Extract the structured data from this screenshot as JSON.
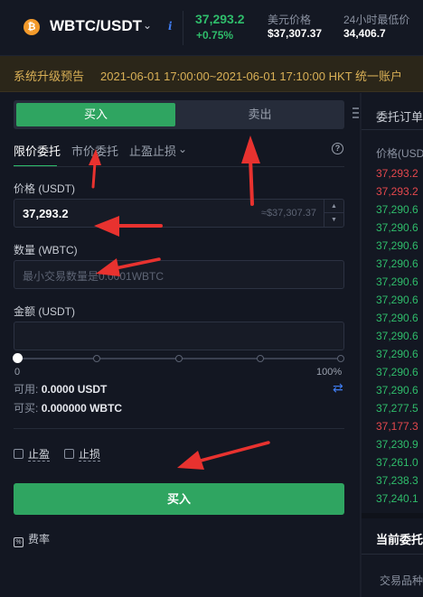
{
  "header": {
    "coin_icon": "bitcoin-icon",
    "coin_glyph": "₿",
    "pair": "WBTC/USDT",
    "caret": "⌄",
    "info_glyph": "i",
    "last_price": "37,293.2",
    "change": "+0.75%",
    "usd_price_label": "美元价格",
    "usd_price_value": "$37,307.37",
    "low_24h_label": "24小时最低价",
    "low_24h_value": "34,406.7"
  },
  "notice": {
    "title": "系统升级预告",
    "text": "2021-06-01 17:00:00~2021-06-01 17:10:00 HKT 统一账户"
  },
  "trade": {
    "buy_tab": "买入",
    "sell_tab": "卖出",
    "order_tabs": [
      "限价委托",
      "市价委托",
      "止盈止损"
    ],
    "dropdown_caret": "⌄",
    "help_glyph": "?",
    "price_label": "价格 (USDT)",
    "price_value": "37,293.2",
    "price_hint": "≈$37,307.37",
    "stepper_up": "▲",
    "stepper_down": "▼",
    "amount_label": "数量 (WBTC)",
    "amount_placeholder": "最小交易数量是0.0001WBTC",
    "total_label": "金额 (USDT)",
    "total_value": "",
    "slider_min": "0",
    "slider_max": "100%",
    "slider_value": 0,
    "available_label": "可用:",
    "available_value": "0.0000 USDT",
    "can_buy_label": "可买:",
    "can_buy_value": "0.000000 WBTC",
    "swap_glyph": "⇄",
    "take_profit": "止盈",
    "stop_loss": "止损",
    "submit": "买入",
    "fee_icon_glyph": "%",
    "fee": "费率"
  },
  "orderbook": {
    "title": "委托订单",
    "col_price": "价格(USDT)",
    "rows": [
      {
        "price": "37,293.2",
        "side": "sell"
      },
      {
        "price": "37,293.2",
        "side": "sell"
      },
      {
        "price": "37,290.6",
        "side": "buy"
      },
      {
        "price": "37,290.6",
        "side": "buy"
      },
      {
        "price": "37,290.6",
        "side": "buy"
      },
      {
        "price": "37,290.6",
        "side": "buy"
      },
      {
        "price": "37,290.6",
        "side": "buy"
      },
      {
        "price": "37,290.6",
        "side": "buy"
      },
      {
        "price": "37,290.6",
        "side": "buy"
      },
      {
        "price": "37,290.6",
        "side": "buy"
      },
      {
        "price": "37,290.6",
        "side": "buy"
      },
      {
        "price": "37,290.6",
        "side": "buy"
      },
      {
        "price": "37,290.6",
        "side": "buy"
      },
      {
        "price": "37,277.5",
        "side": "buy"
      },
      {
        "price": "37,177.3",
        "side": "sell"
      },
      {
        "price": "37,230.9",
        "side": "buy"
      },
      {
        "price": "37,261.0",
        "side": "buy"
      },
      {
        "price": "37,238.3",
        "side": "buy"
      },
      {
        "price": "37,240.1",
        "side": "buy"
      }
    ],
    "current_orders_title": "当前委托",
    "col_symbol": "交易品种"
  },
  "colors": {
    "buy": "#2fbd6b",
    "sell": "#e5484d",
    "annotation_arrow": "#e8322f"
  }
}
